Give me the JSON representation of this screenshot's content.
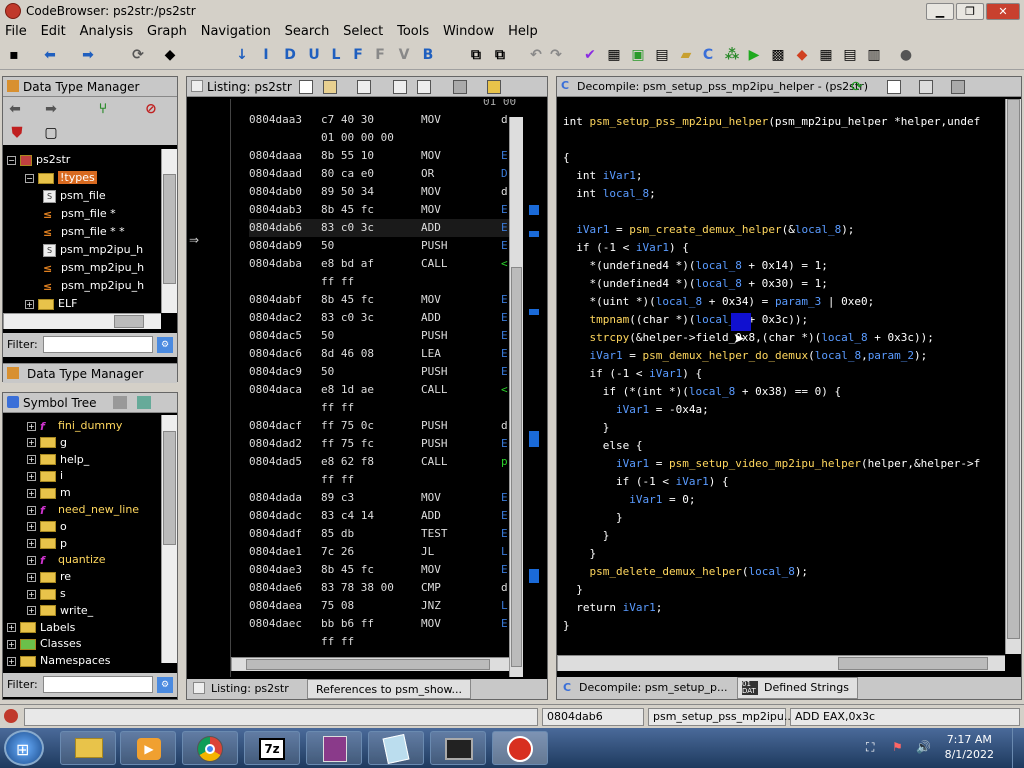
{
  "window": {
    "title": "CodeBrowser: ps2str:/ps2str",
    "min": "▁",
    "max": "❐",
    "close": "✕"
  },
  "menu": [
    "File",
    "Edit",
    "Analysis",
    "Graph",
    "Navigation",
    "Search",
    "Select",
    "Tools",
    "Window",
    "Help"
  ],
  "dtm": {
    "title": "Data Type Manager",
    "tab_label": "Data Type Manager",
    "filter_label": "Filter:",
    "filter_value": "",
    "tree": [
      {
        "label": "ps2str",
        "indent": 0,
        "icon": "book-icon",
        "exp": "−"
      },
      {
        "label": "!types",
        "indent": 1,
        "icon": "folder-icon",
        "exp": "−",
        "selected": true
      },
      {
        "label": "psm_file",
        "indent": 2,
        "icon": "struct-icon"
      },
      {
        "label": "psm_file *",
        "indent": 2,
        "icon": "pointer-icon"
      },
      {
        "label": "psm_file * *",
        "indent": 2,
        "icon": "pointer-icon"
      },
      {
        "label": "psm_mp2ipu_h",
        "indent": 2,
        "icon": "struct-icon"
      },
      {
        "label": "psm_mp2ipu_h",
        "indent": 2,
        "icon": "pointer-icon"
      },
      {
        "label": "psm_mp2ipu_h",
        "indent": 2,
        "icon": "pointer-icon"
      },
      {
        "label": "ELF",
        "indent": 1,
        "icon": "folder-icon",
        "exp": "+"
      }
    ]
  },
  "symtree": {
    "title": "Symbol Tree",
    "filter_label": "Filter:",
    "filter_value": "",
    "items": [
      {
        "label": "fini_dummy",
        "type": "fn"
      },
      {
        "label": "g",
        "type": "folder"
      },
      {
        "label": "help_",
        "type": "folder"
      },
      {
        "label": "i",
        "type": "folder"
      },
      {
        "label": "m",
        "type": "folder"
      },
      {
        "label": "need_new_line",
        "type": "fn"
      },
      {
        "label": "o",
        "type": "folder"
      },
      {
        "label": "p",
        "type": "folder"
      },
      {
        "label": "quantize",
        "type": "fn"
      },
      {
        "label": "re",
        "type": "folder"
      },
      {
        "label": "s",
        "type": "folder"
      },
      {
        "label": "write_",
        "type": "folder"
      }
    ],
    "roots": [
      {
        "label": "Labels"
      },
      {
        "label": "Classes"
      },
      {
        "label": "Namespaces"
      }
    ]
  },
  "listing": {
    "title": "Listing:  ps2str",
    "tab_label": "Listing:  ps2str",
    "tab2_label": "References to psm_show...",
    "top_partial": "01 00 00 00",
    "rows": [
      {
        "addr": "0804daa3",
        "bytes": "c7 40 30",
        "mn": "MOV",
        "op": "d"
      },
      {
        "addr": "",
        "bytes": "01 00 00 00",
        "mn": "",
        "op": ""
      },
      {
        "addr": "0804daaa",
        "bytes": "8b 55 10",
        "mn": "MOV",
        "op": "E"
      },
      {
        "addr": "0804daad",
        "bytes": "80 ca e0",
        "mn": "OR",
        "op": "D"
      },
      {
        "addr": "0804dab0",
        "bytes": "89 50 34",
        "mn": "MOV",
        "op": "d"
      },
      {
        "addr": "0804dab3",
        "bytes": "8b 45 fc",
        "mn": "MOV",
        "op": "E"
      },
      {
        "addr": "0804dab6",
        "bytes": "83 c0 3c",
        "mn": "ADD",
        "op": "E",
        "cur": true
      },
      {
        "addr": "0804dab9",
        "bytes": "50",
        "mn": "PUSH",
        "op": "E"
      },
      {
        "addr": "0804daba",
        "bytes": "e8 bd af",
        "mn": "CALL",
        "op": "<"
      },
      {
        "addr": "",
        "bytes": "ff ff",
        "mn": "",
        "op": ""
      },
      {
        "addr": "0804dabf",
        "bytes": "8b 45 fc",
        "mn": "MOV",
        "op": "E"
      },
      {
        "addr": "0804dac2",
        "bytes": "83 c0 3c",
        "mn": "ADD",
        "op": "E"
      },
      {
        "addr": "0804dac5",
        "bytes": "50",
        "mn": "PUSH",
        "op": "E"
      },
      {
        "addr": "0804dac6",
        "bytes": "8d 46 08",
        "mn": "LEA",
        "op": "E"
      },
      {
        "addr": "0804dac9",
        "bytes": "50",
        "mn": "PUSH",
        "op": "E"
      },
      {
        "addr": "0804daca",
        "bytes": "e8 1d ae",
        "mn": "CALL",
        "op": "<"
      },
      {
        "addr": "",
        "bytes": "ff ff",
        "mn": "",
        "op": ""
      },
      {
        "addr": "0804dacf",
        "bytes": "ff 75 0c",
        "mn": "PUSH",
        "op": "d"
      },
      {
        "addr": "0804dad2",
        "bytes": "ff 75 fc",
        "mn": "PUSH",
        "op": "E"
      },
      {
        "addr": "0804dad5",
        "bytes": "e8 62 f8",
        "mn": "CALL",
        "op": "p"
      },
      {
        "addr": "",
        "bytes": "ff ff",
        "mn": "",
        "op": ""
      },
      {
        "addr": "0804dada",
        "bytes": "89 c3",
        "mn": "MOV",
        "op": "E"
      },
      {
        "addr": "0804dadc",
        "bytes": "83 c4 14",
        "mn": "ADD",
        "op": "E"
      },
      {
        "addr": "0804dadf",
        "bytes": "85 db",
        "mn": "TEST",
        "op": "E"
      },
      {
        "addr": "0804dae1",
        "bytes": "7c 26",
        "mn": "JL",
        "op": "L"
      },
      {
        "addr": "0804dae3",
        "bytes": "8b 45 fc",
        "mn": "MOV",
        "op": "E"
      },
      {
        "addr": "0804dae6",
        "bytes": "83 78 38 00",
        "mn": "CMP",
        "op": "d"
      },
      {
        "addr": "0804daea",
        "bytes": "75 08",
        "mn": "JNZ",
        "op": "L"
      },
      {
        "addr": "0804daec",
        "bytes": "bb b6 ff",
        "mn": "MOV",
        "op": "E"
      },
      {
        "addr": "",
        "bytes": "ff ff",
        "mn": "",
        "op": ""
      }
    ]
  },
  "decomp": {
    "title": "Decompile: psm_setup_pss_mp2ipu_helper - (ps2str)",
    "tab_label": "Decompile: psm_setup_p...",
    "tab2_label": "Defined Strings",
    "lines": [
      "int psm_setup_pss_mp2ipu_helper(psm_mp2ipu_helper *helper,undef",
      "",
      "{",
      "  int iVar1;",
      "  int local_8;",
      "",
      "  iVar1 = psm_create_demux_helper(&local_8);",
      "  if (-1 < iVar1) {",
      "    *(undefined4 *)(local_8 + 0x14) = 1;",
      "    *(undefined4 *)(local_8 + 0x30) = 1;",
      "    *(uint *)(local_8 + 0x34) = param_3 | 0xe0;",
      "    tmpnam((char *)(local_8 + 0x3c));",
      "    strcpy(&helper->field_0x8,(char *)(local_8 + 0x3c));",
      "    iVar1 = psm_demux_helper_do_demux(local_8,param_2);",
      "    if (-1 < iVar1) {",
      "      if (*(int *)(local_8 + 0x38) == 0) {",
      "        iVar1 = -0x4a;",
      "      }",
      "      else {",
      "        iVar1 = psm_setup_video_mp2ipu_helper(helper,&helper->f",
      "        if (-1 < iVar1) {",
      "          iVar1 = 0;",
      "        }",
      "      }",
      "    }",
      "    psm_delete_demux_helper(local_8);",
      "  }",
      "  return iVar1;",
      "}"
    ]
  },
  "status": {
    "addr": "0804dab6",
    "func": "psm_setup_pss_mp2ipu...",
    "instr": "ADD EAX,0x3c"
  },
  "clock": {
    "time": "7:17 AM",
    "date": "8/1/2022"
  },
  "taskbar_apps": [
    "start-orb",
    "file-explorer",
    "media-player",
    "chrome",
    "7zip",
    "archive-tool",
    "notepad",
    "terminal",
    "ghidra"
  ]
}
